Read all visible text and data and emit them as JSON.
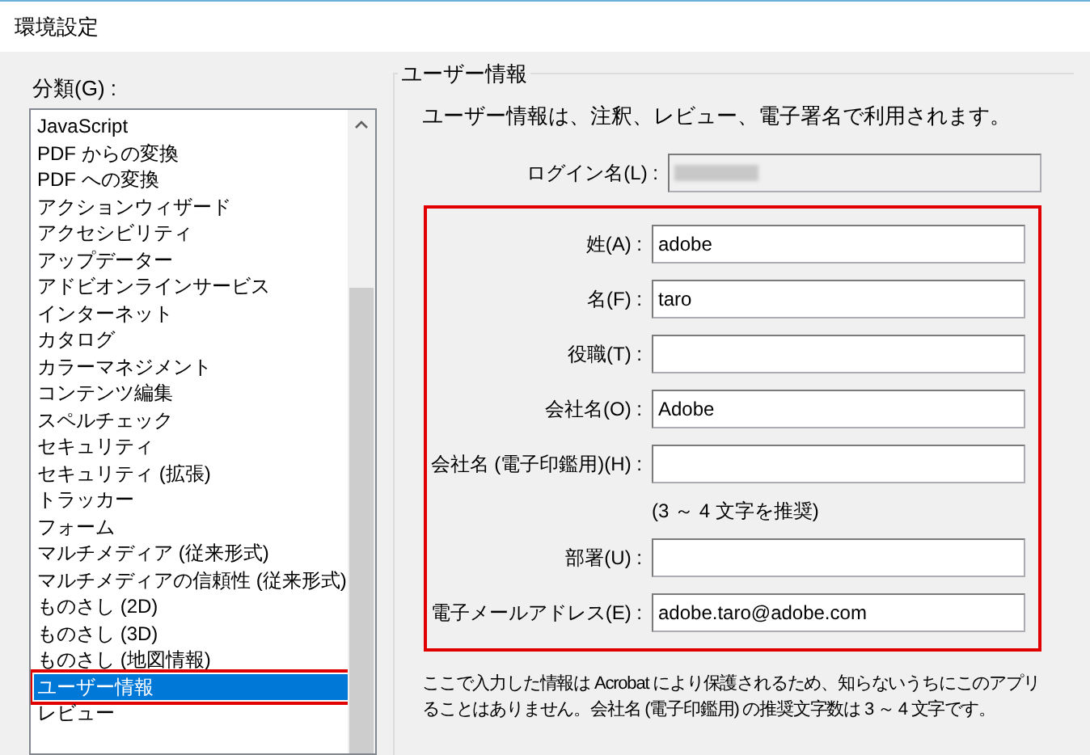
{
  "window": {
    "title": "環境設定"
  },
  "category": {
    "label": "分類(G) :",
    "items": [
      {
        "label": "JavaScript",
        "selected": false
      },
      {
        "label": "PDF からの変換",
        "selected": false
      },
      {
        "label": "PDF への変換",
        "selected": false
      },
      {
        "label": "アクションウィザード",
        "selected": false
      },
      {
        "label": "アクセシビリティ",
        "selected": false
      },
      {
        "label": "アップデーター",
        "selected": false
      },
      {
        "label": "アドビオンラインサービス",
        "selected": false
      },
      {
        "label": "インターネット",
        "selected": false
      },
      {
        "label": "カタログ",
        "selected": false
      },
      {
        "label": "カラーマネジメント",
        "selected": false
      },
      {
        "label": "コンテンツ編集",
        "selected": false
      },
      {
        "label": "スペルチェック",
        "selected": false
      },
      {
        "label": "セキュリティ",
        "selected": false
      },
      {
        "label": "セキュリティ (拡張)",
        "selected": false
      },
      {
        "label": "トラッカー",
        "selected": false
      },
      {
        "label": "フォーム",
        "selected": false
      },
      {
        "label": "マルチメディア (従来形式)",
        "selected": false
      },
      {
        "label": "マルチメディアの信頼性 (従来形式)",
        "selected": false
      },
      {
        "label": "ものさし (2D)",
        "selected": false
      },
      {
        "label": "ものさし (3D)",
        "selected": false
      },
      {
        "label": "ものさし (地図情報)",
        "selected": false
      },
      {
        "label": "ユーザー情報",
        "selected": true
      },
      {
        "label": "レビュー",
        "selected": false
      }
    ]
  },
  "panel": {
    "title": "ユーザー情報",
    "description": "ユーザー情報は、注釈、レビュー、電子署名で利用されます。",
    "login": {
      "label": "ログイン名(L) :",
      "disabled": true
    },
    "rows": [
      {
        "kind": "field",
        "label": "姓(A) :",
        "value": "adobe"
      },
      {
        "kind": "field",
        "label": "名(F) :",
        "value": "taro"
      },
      {
        "kind": "field",
        "label": "役職(T) :"
      },
      {
        "kind": "field",
        "label": "会社名(O) :",
        "value": "Adobe"
      },
      {
        "kind": "field",
        "label": "会社名 (電子印鑑用)(H) :"
      },
      {
        "kind": "hint",
        "text": "(3 ～ 4 文字を推奨)"
      },
      {
        "kind": "field",
        "label": "部署(U) :"
      },
      {
        "kind": "field",
        "label": "電子メールアドレス(E) :",
        "value": "adobe.taro@adobe.com"
      }
    ],
    "note": [
      "ここで入力した情報は Acrobat により保護されるため、知らないうちにこのアプリ",
      "ることはありません。会社名 (電子印鑑用) の推奨文字数は 3 ～ 4 文字です。"
    ]
  }
}
